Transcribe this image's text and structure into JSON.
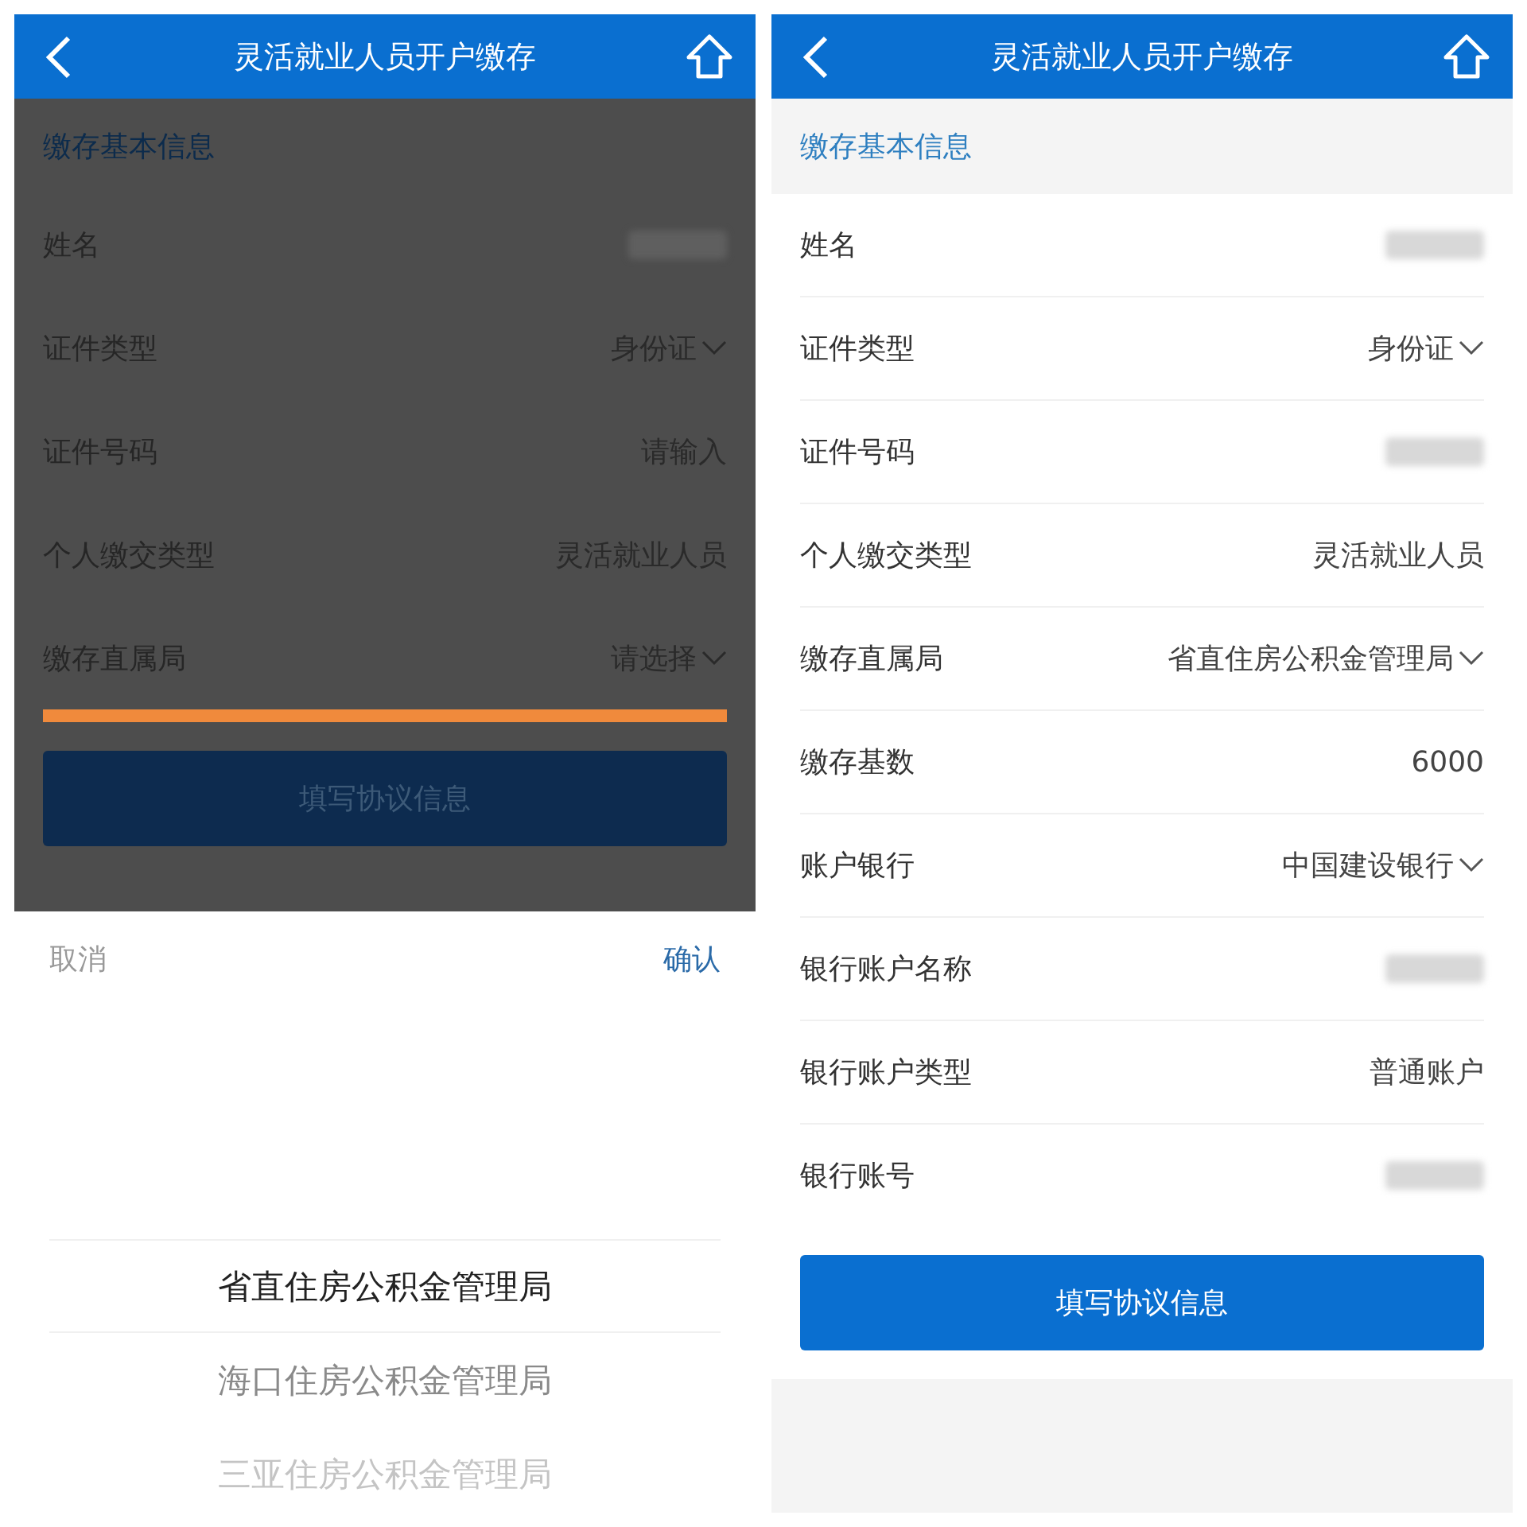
{
  "screens": [
    {
      "title": "灵活就业人员开户缴存",
      "dimmed": true,
      "section": "缴存基本信息",
      "rows": [
        {
          "label": "姓名",
          "kind": "redacted",
          "highlighted": false
        },
        {
          "label": "证件类型",
          "kind": "select",
          "value": "身份证",
          "highlighted": false
        },
        {
          "label": "证件号码",
          "kind": "placeholder",
          "placeholder": "请输入",
          "highlighted": false
        },
        {
          "label": "个人缴交类型",
          "kind": "text",
          "value": "灵活就业人员",
          "highlighted": false
        },
        {
          "label": "缴存直属局",
          "kind": "select",
          "value": "请选择",
          "highlighted": true
        }
      ],
      "button": "填写协议信息",
      "picker": {
        "cancel": "取消",
        "confirm": "确认",
        "options": [
          {
            "label": "省直住房公积金管理局",
            "selected": true
          },
          {
            "label": "海口住房公积金管理局",
            "selected": false
          },
          {
            "label": "三亚住房公积金管理局",
            "selected": false
          }
        ]
      }
    },
    {
      "title": "灵活就业人员开户缴存",
      "dimmed": false,
      "section": "缴存基本信息",
      "rows": [
        {
          "label": "姓名",
          "kind": "redacted",
          "highlighted": false
        },
        {
          "label": "证件类型",
          "kind": "select",
          "value": "身份证",
          "highlighted": false
        },
        {
          "label": "证件号码",
          "kind": "redacted",
          "highlighted": false
        },
        {
          "label": "个人缴交类型",
          "kind": "text",
          "value": "灵活就业人员",
          "highlighted": false
        },
        {
          "label": "缴存直属局",
          "kind": "select",
          "value": "省直住房公积金管理局",
          "highlighted": false
        },
        {
          "label": "缴存基数",
          "kind": "text",
          "value": "6000",
          "highlighted": false
        },
        {
          "label": "账户银行",
          "kind": "select",
          "value": "中国建设银行",
          "highlighted": false
        },
        {
          "label": "银行账户名称",
          "kind": "redacted",
          "highlighted": false
        },
        {
          "label": "银行账户类型",
          "kind": "text",
          "value": "普通账户",
          "highlighted": false
        },
        {
          "label": "银行账号",
          "kind": "redacted",
          "highlighted": false
        }
      ],
      "button": "填写协议信息"
    }
  ]
}
